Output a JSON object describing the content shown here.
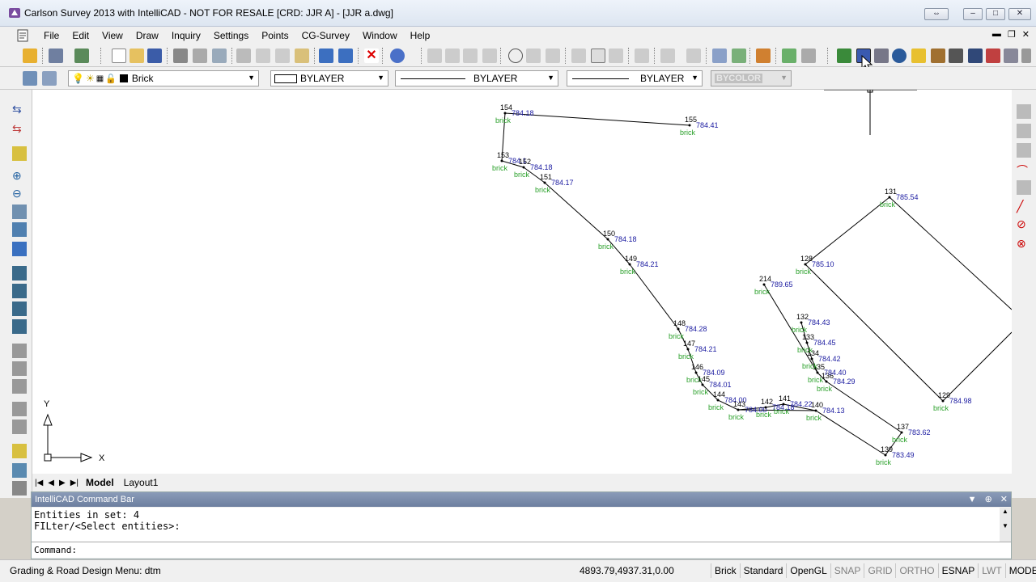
{
  "window": {
    "title": "Carlson Survey 2013 with IntelliCAD - NOT FOR RESALE [CRD: JJR A] - [JJR a.dwg]"
  },
  "menu": {
    "items": [
      "File",
      "Edit",
      "View",
      "Draw",
      "Inquiry",
      "Settings",
      "Points",
      "CG-Survey",
      "Window",
      "Help"
    ]
  },
  "properties_bar": {
    "layer": "Brick",
    "color": "BYLAYER",
    "linetype": "BYLAYER",
    "lineweight": "BYLAYER",
    "plotstyle": "BYCOLOR"
  },
  "tabs": {
    "model": "Model",
    "layout1": "Layout1"
  },
  "ucs": {
    "x_label": "X",
    "y_label": "Y"
  },
  "points": [
    {
      "id": "154",
      "elev": "784.18",
      "desc": "brick"
    },
    {
      "id": "155",
      "elev": "784.41",
      "desc": "brick"
    },
    {
      "id": "153",
      "elev": "784.1",
      "desc": "brick"
    },
    {
      "id": "152",
      "elev": "784.18",
      "desc": "brick"
    },
    {
      "id": "151",
      "elev": "784.17",
      "desc": "brick"
    },
    {
      "id": "150",
      "elev": "784.18",
      "desc": "brick"
    },
    {
      "id": "149",
      "elev": "784.21",
      "desc": "brick"
    },
    {
      "id": "148",
      "elev": "784.28",
      "desc": "brick"
    },
    {
      "id": "147",
      "elev": "784.21",
      "desc": "brick"
    },
    {
      "id": "146",
      "elev": "784.09",
      "desc": "brick"
    },
    {
      "id": "145",
      "elev": "784.01",
      "desc": "brick"
    },
    {
      "id": "144",
      "elev": "784.00",
      "desc": "brick"
    },
    {
      "id": "143",
      "elev": "784.00",
      "desc": "brick"
    },
    {
      "id": "142",
      "elev": "784.18",
      "desc": "brick"
    },
    {
      "id": "141",
      "elev": "784.22",
      "desc": "brick"
    },
    {
      "id": "140",
      "elev": "784.13",
      "desc": "brick"
    },
    {
      "id": "139",
      "elev": "783.49",
      "desc": "brick"
    },
    {
      "id": "137",
      "elev": "783.62",
      "desc": "brick"
    },
    {
      "id": "136",
      "elev": "784.29",
      "desc": "brick"
    },
    {
      "id": "135",
      "elev": "784.40",
      "desc": "brick"
    },
    {
      "id": "134",
      "elev": "784.42",
      "desc": "brick"
    },
    {
      "id": "133",
      "elev": "784.45",
      "desc": "brick"
    },
    {
      "id": "132",
      "elev": "784.43",
      "desc": "brick"
    },
    {
      "id": "214",
      "elev": "789.65",
      "desc": "brick"
    },
    {
      "id": "128",
      "elev": "785.10",
      "desc": "brick"
    },
    {
      "id": "131",
      "elev": "785.54",
      "desc": "brick"
    },
    {
      "id": "129",
      "elev": "784.98",
      "desc": "brick"
    }
  ],
  "command_bar": {
    "title": "IntelliCAD Command Bar",
    "history_line1": "Entities in set: 4",
    "history_line2": "FILter/<Select entities>:",
    "prompt": "Command:"
  },
  "status": {
    "menu": "Grading & Road Design Menu: dtm",
    "coords": "4893.79,4937.31,0.00",
    "layer": "Brick",
    "text_style": "Standard",
    "render": "OpenGL",
    "toggles": [
      "SNAP",
      "GRID",
      "ORTHO",
      "ESNAP",
      "LWT",
      "MODEL"
    ]
  },
  "colors": {
    "point_label": "#000000",
    "elevation": "#1a1aa0",
    "description": "#2aa02a",
    "linework": "#000000"
  }
}
